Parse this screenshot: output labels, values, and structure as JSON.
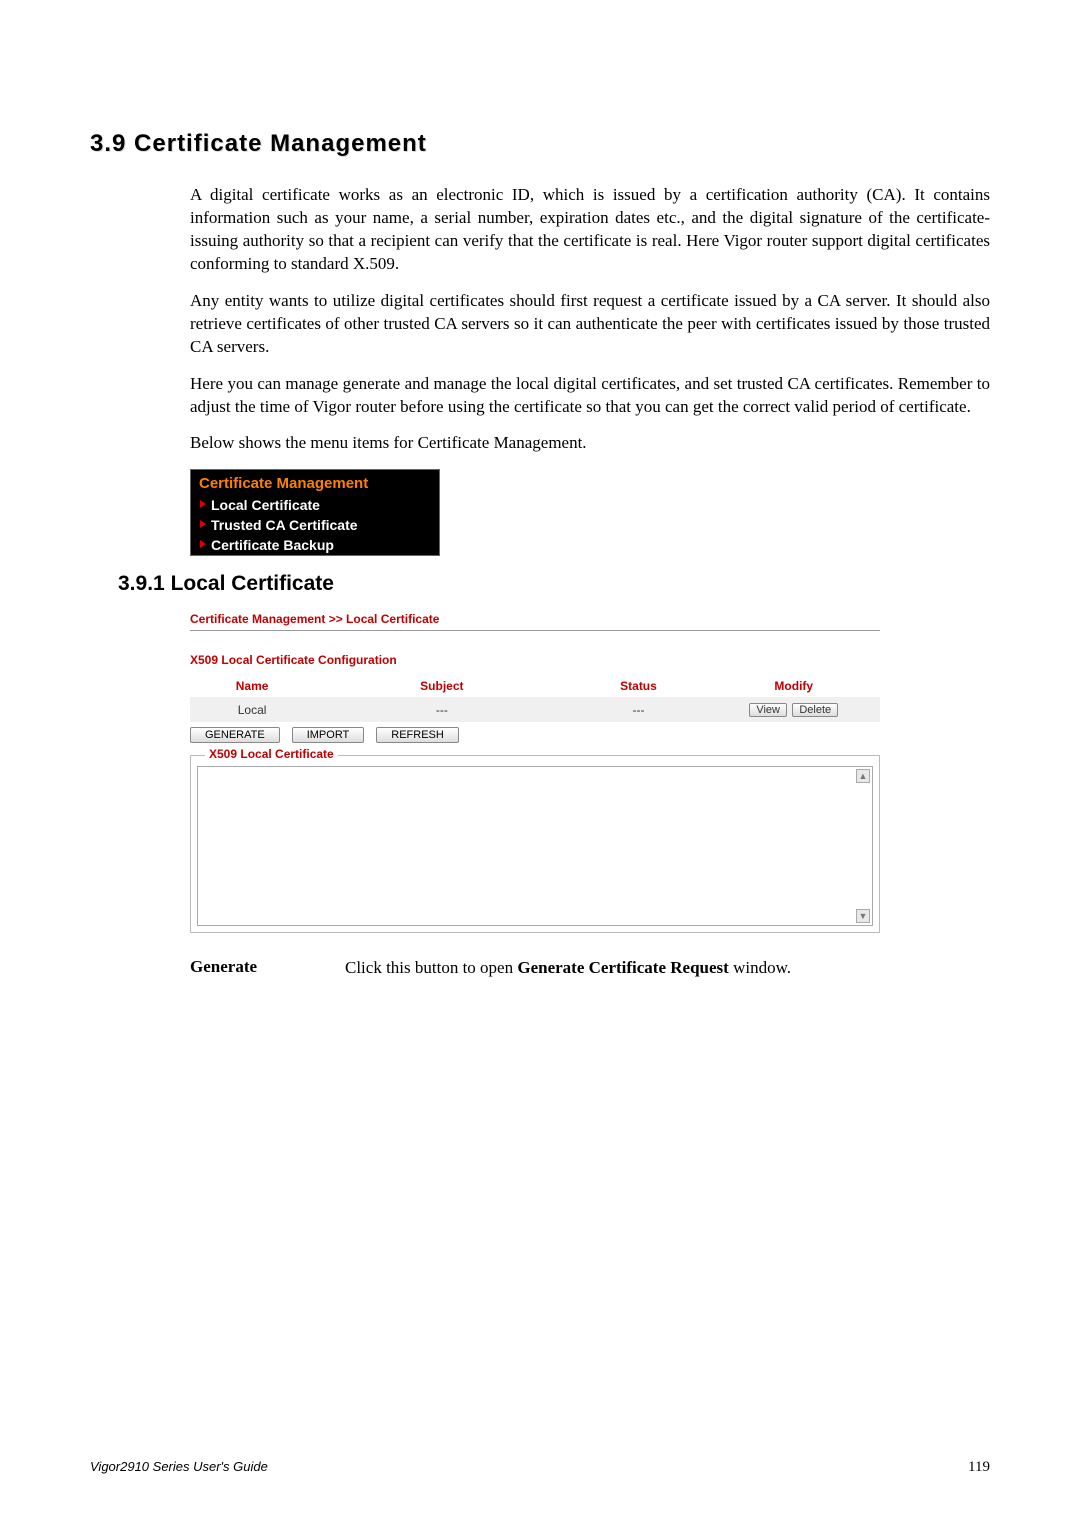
{
  "section": {
    "number": "3.9",
    "title": "Certificate Management"
  },
  "paragraphs": {
    "p1": "A digital certificate works as an electronic ID, which is issued by a certification authority (CA). It contains information such as your name, a serial number, expiration dates etc., and the digital signature of the certificate-issuing authority so that a recipient can verify that the certificate is real. Here Vigor router support digital certificates conforming to standard X.509.",
    "p2": "Any entity wants to utilize digital certificates should first request a certificate issued by a CA server. It should also retrieve certificates of other trusted CA servers so it can authenticate the peer with certificates issued by those trusted CA servers.",
    "p3": "Here you can manage generate and manage the local digital certificates, and set trusted CA certificates. Remember to adjust the time of Vigor router before using the certificate so that you can get the correct valid period of certificate.",
    "p4": "Below shows the menu items for Certificate Management."
  },
  "menu": {
    "title": "Certificate Management",
    "items": [
      "Local Certificate",
      "Trusted CA Certificate",
      "Certificate Backup"
    ]
  },
  "subsection": {
    "number": "3.9.1",
    "title": "Local Certificate"
  },
  "screenshot": {
    "breadcrumb": "Certificate Management >> Local Certificate",
    "config_title": "X509 Local Certificate Configuration",
    "table": {
      "headers": [
        "Name",
        "Subject",
        "Status",
        "Modify"
      ],
      "row": {
        "name": "Local",
        "subject": "---",
        "status": "---",
        "btn_view": "View",
        "btn_delete": "Delete"
      }
    },
    "buttons": {
      "generate": "GENERATE",
      "import": "IMPORT",
      "refresh": "REFRESH"
    },
    "fieldset_legend": "X509 Local Certificate"
  },
  "description": {
    "label": "Generate",
    "text_prefix": "Click this button to open ",
    "text_bold": "Generate Certificate Request",
    "text_suffix": " window."
  },
  "footer": {
    "guide": "Vigor2910 Series User's Guide",
    "page": "119"
  }
}
